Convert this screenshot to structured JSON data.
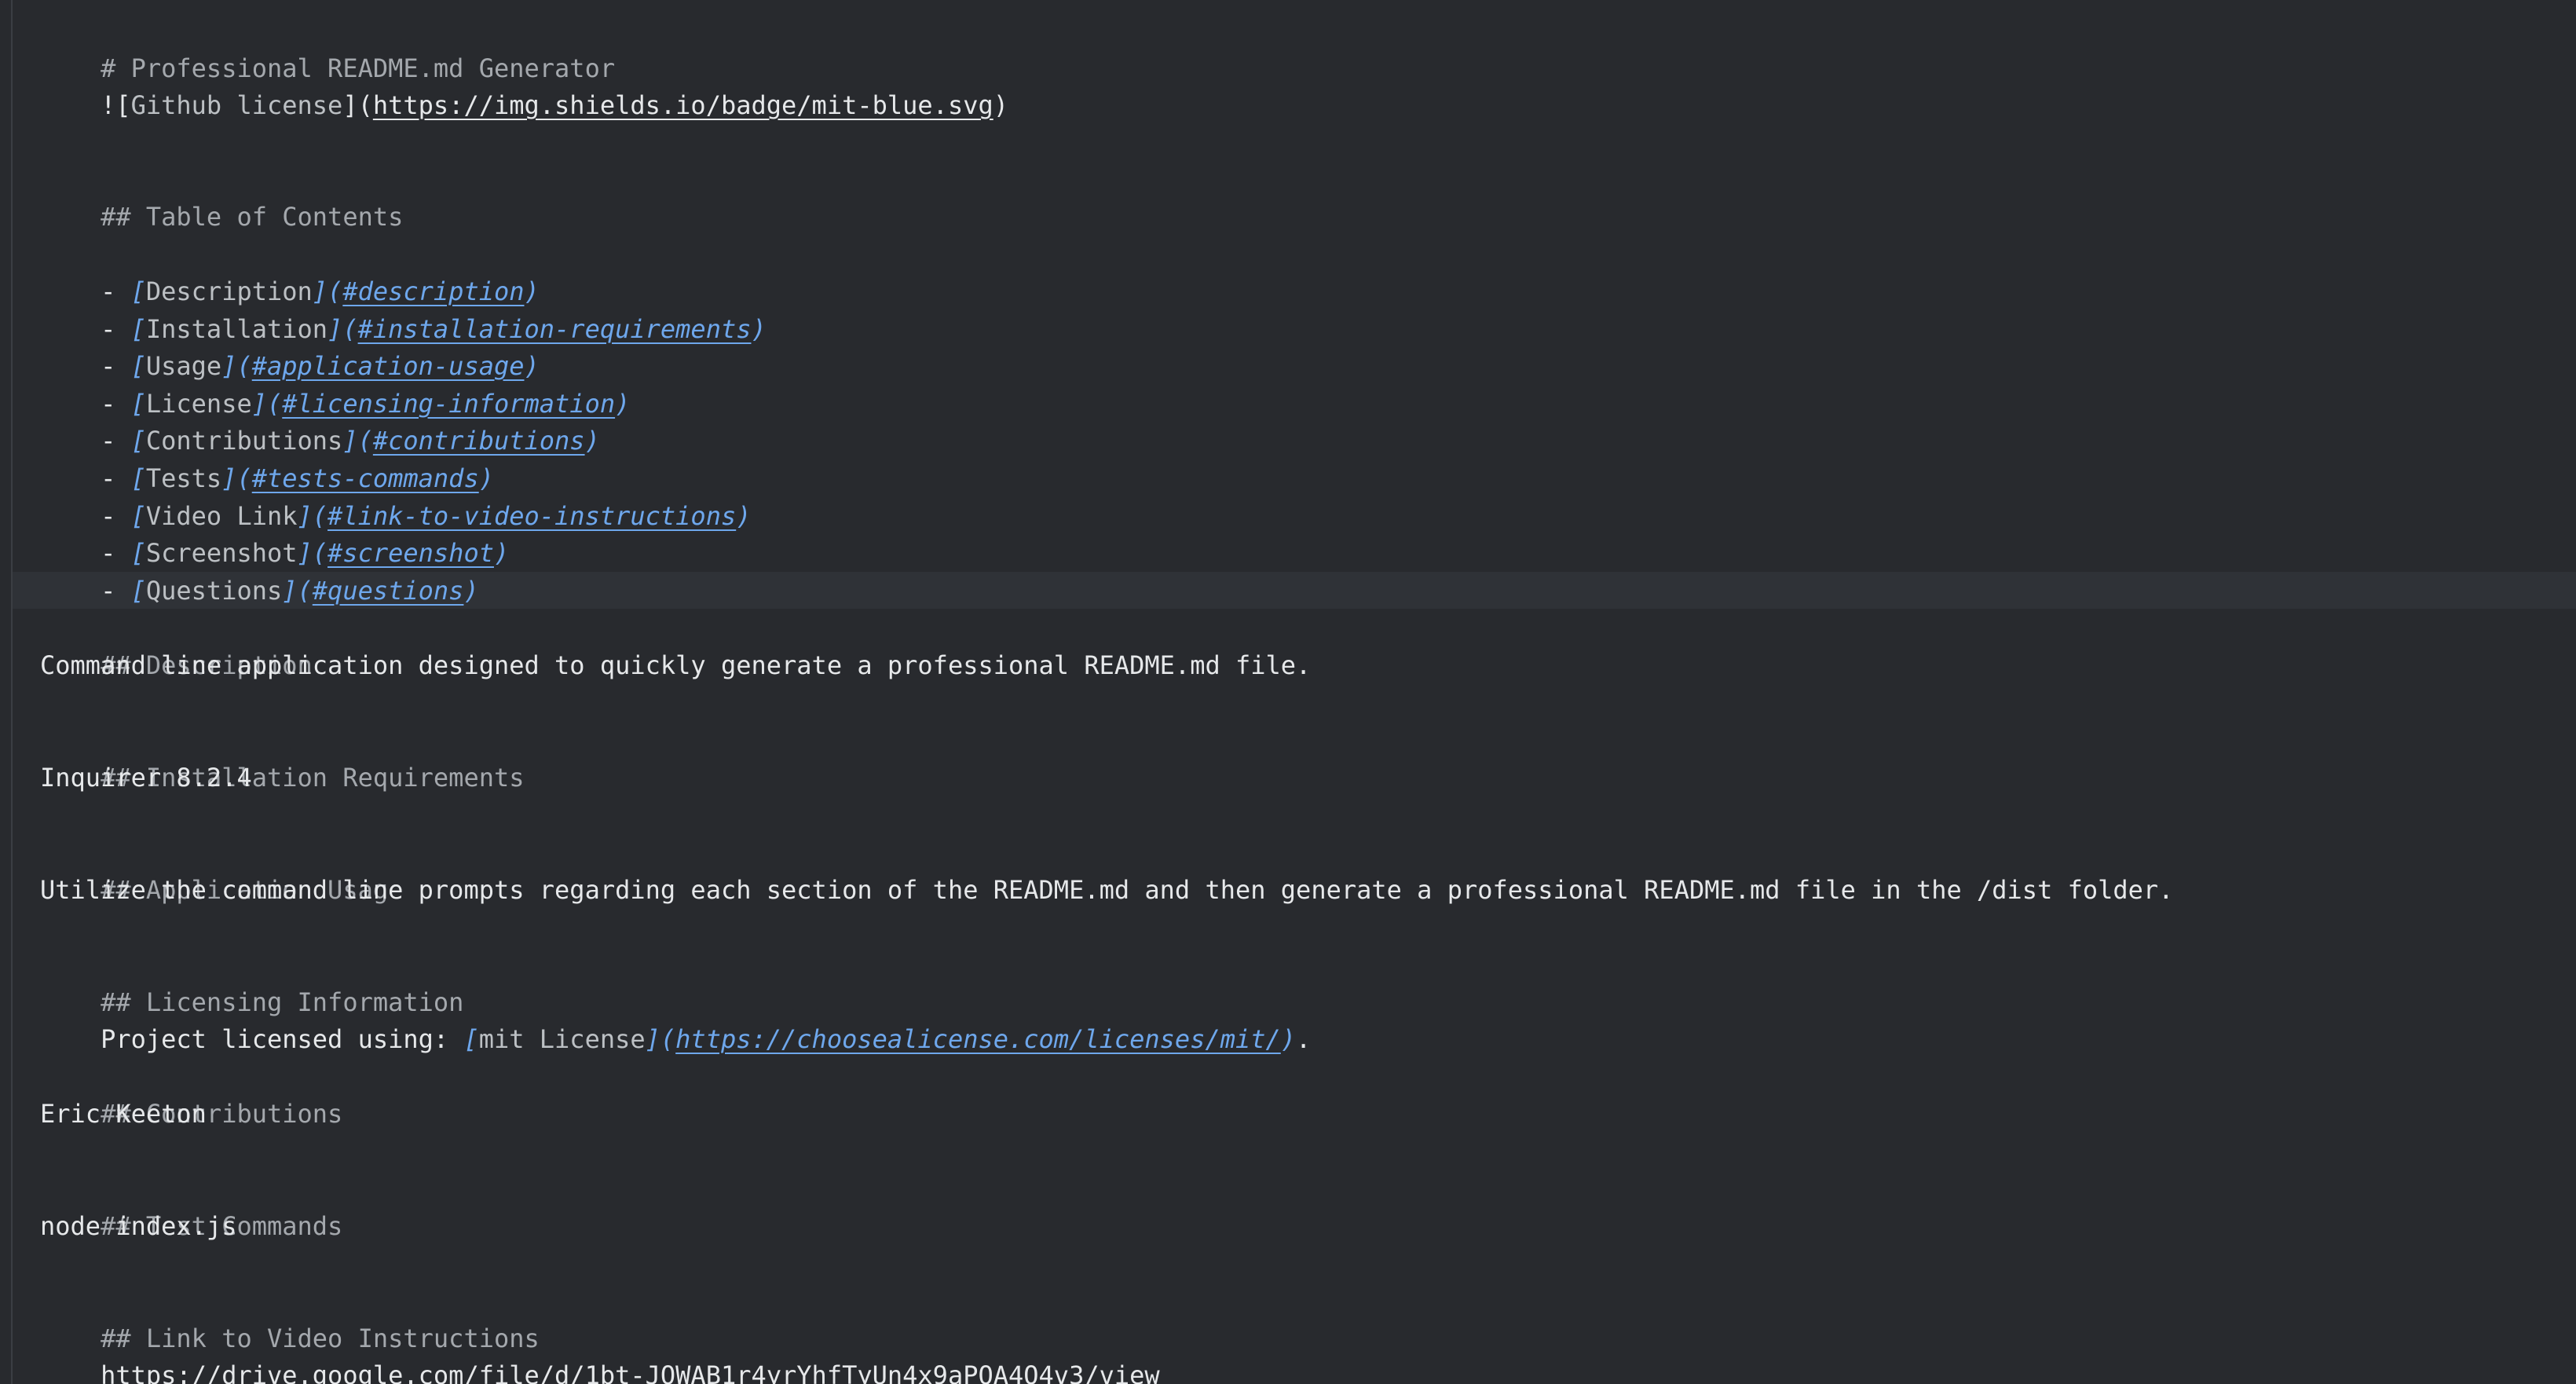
{
  "title_line": {
    "mark": "#",
    "text": " Professional README.md Generator"
  },
  "badge_line": {
    "prefix": "![",
    "alt": "Github license",
    "mid": "](",
    "url": "https://img.shields.io/badge/mit-blue.svg",
    "suffix": ")"
  },
  "toc_heading": {
    "mark": "##",
    "text": " Table of Contents"
  },
  "toc_items": [
    {
      "dash": "- ",
      "label": "Description",
      "anchor": "#description"
    },
    {
      "dash": "- ",
      "label": "Installation",
      "anchor": "#installation-requirements"
    },
    {
      "dash": "- ",
      "label": "Usage",
      "anchor": "#application-usage"
    },
    {
      "dash": "- ",
      "label": "License",
      "anchor": "#licensing-information"
    },
    {
      "dash": "- ",
      "label": "Contributions",
      "anchor": "#contributions"
    },
    {
      "dash": "- ",
      "label": "Tests",
      "anchor": "#tests-commands"
    },
    {
      "dash": "- ",
      "label": "Video Link",
      "anchor": "#link-to-video-instructions"
    },
    {
      "dash": "- ",
      "label": "Screenshot",
      "anchor": "#screenshot"
    },
    {
      "dash": "- ",
      "label": "Questions",
      "anchor": "#questions"
    }
  ],
  "sections": [
    {
      "mark": "##",
      "heading": " Description",
      "body": "Command line application designed to quickly generate a professional README.md file."
    },
    {
      "mark": "##",
      "heading": " Installation Requirements",
      "body": "Inquirer 8.2.4"
    },
    {
      "mark": "##",
      "heading": " Application Usage",
      "body": "Utilize the command line prompts regarding each section of the README.md and then generate a professional README.md file in the /dist folder."
    },
    {
      "mark": "##",
      "heading": " Licensing Information"
    },
    {
      "mark": "##",
      "heading": " Contributions",
      "body": "Eric Keeton"
    },
    {
      "mark": "##",
      "heading": " Test Commands",
      "body": "node index.js"
    },
    {
      "mark": "##",
      "heading": " Link to Video Instructions"
    }
  ],
  "license_line": {
    "prefix": "Project licensed using: ",
    "label": "mit License",
    "url": "https://choosealicense.com/licenses/mit/",
    "suffix": "."
  },
  "video_url": "https://drive.google.com/file/d/1bt-JOWAB1r4yrYhfTyUn4x9aPQA4O4v3/view",
  "bracket_open": "[",
  "bracket_close": "](",
  "paren_close": ")",
  "colors": {
    "background": "#282a2e",
    "text": "#e6e8ea",
    "muted": "#a4a8ad",
    "link": "#6ea7ec",
    "active_line": "#2f3237"
  }
}
